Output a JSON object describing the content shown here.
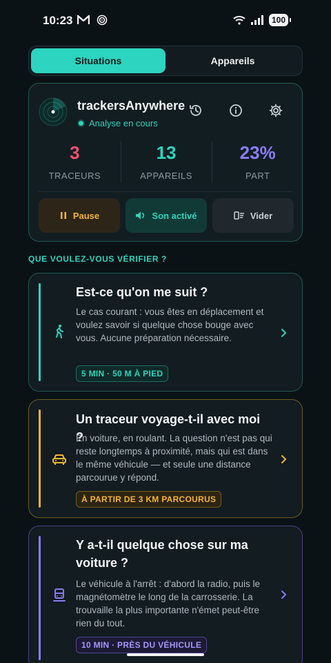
{
  "status_bar": {
    "time": "10:23",
    "battery": "100",
    "icons": [
      "gmail-icon",
      "sync-icon",
      "wifi-icon",
      "signal-icon",
      "battery-icon"
    ]
  },
  "tabs": [
    {
      "label": "Situations",
      "active": true
    },
    {
      "label": "Appareils",
      "active": false
    }
  ],
  "scanner": {
    "app_name": "trackersAnywhere",
    "status": "Analyse en cours",
    "icons": [
      "history-icon",
      "info-icon",
      "settings-icon"
    ],
    "stats": [
      {
        "value": "3",
        "label": "TRACEURS",
        "color": "#f0506e"
      },
      {
        "value": "13",
        "label": "APPAREILS",
        "color": "#2dd4bf"
      },
      {
        "value": "23%",
        "label": "PART",
        "color": "#8b7cf6"
      }
    ],
    "actions": {
      "pause": "Pause",
      "sound": "Son activé",
      "clear": "Vider"
    }
  },
  "section_title": "QUE VOULEZ-VOUS VÉRIFIER ?",
  "options": [
    {
      "title": "Est-ce qu'on me suit ?",
      "description": "Le cas courant : vous êtes en déplacement et voulez savoir si quelque chose bouge avec vous. Aucune préparation nécessaire.",
      "tag": "5 MIN · 50 M À PIED",
      "icon": "walking-icon",
      "accent": "#2dd4bf"
    },
    {
      "title": "Un traceur voyage-t-il avec moi ?",
      "description": "En voiture, en roulant. La question n'est pas qui reste longtemps à proximité, mais qui est dans le même véhicule — et seule une distance parcourue y répond.",
      "tag": "À PARTIR DE 3 KM PARCOURUS",
      "icon": "car-icon",
      "accent": "#f5b530"
    },
    {
      "title": "Y a-t-il quelque chose sur ma voiture ?",
      "description": "Le véhicule à l'arrêt : d'abord la radio, puis le magnétomètre le long de la carrosserie. La trouvaille la plus importante n'émet peut-être rien du tout.",
      "tag": "10 MIN · PRÈS DU VÉHICULE",
      "icon": "vehicle-scan-icon",
      "accent": "#8b7cf6"
    }
  ]
}
